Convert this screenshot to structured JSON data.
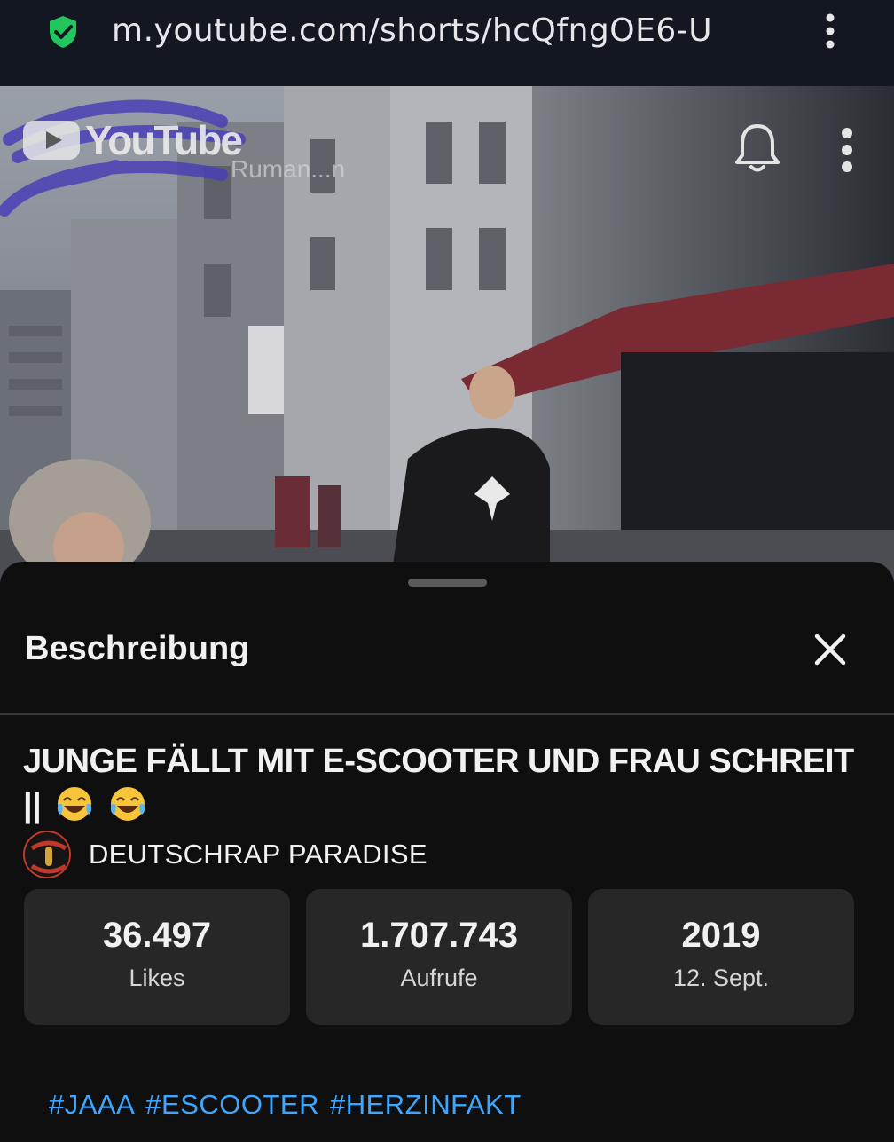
{
  "browser": {
    "url": "m.youtube.com/shorts/hcQfngOE6-U",
    "secure_icon": "shield-check-icon",
    "menu_icon": "more-vertical-icon"
  },
  "video": {
    "logo_text": "YouTube",
    "bell_icon": "bell-icon",
    "menu_icon": "more-vertical-icon"
  },
  "sheet": {
    "title": "Beschreibung",
    "close_icon": "close-icon"
  },
  "description": {
    "video_title": "JUNGE FÄLLT MIT E-SCOOTER UND FRAU SCHREIT ||",
    "title_emoji": "face-with-tears-of-joy",
    "channel_name": "DEUTSCHRAP PARADISE",
    "stats": [
      {
        "value": "36.497",
        "label": "Likes"
      },
      {
        "value": "1.707.743",
        "label": "Aufrufe"
      },
      {
        "value": "2019",
        "label": "12. Sept."
      }
    ],
    "hashtags": [
      "#JAAA",
      "#ESCOOTER",
      "#HERZINFAKT"
    ]
  },
  "colors": {
    "background": "#0f0f0f",
    "urlbar": "#131722",
    "stat_card": "#272727",
    "link": "#3ea6ff",
    "shield": "#22c55e"
  }
}
